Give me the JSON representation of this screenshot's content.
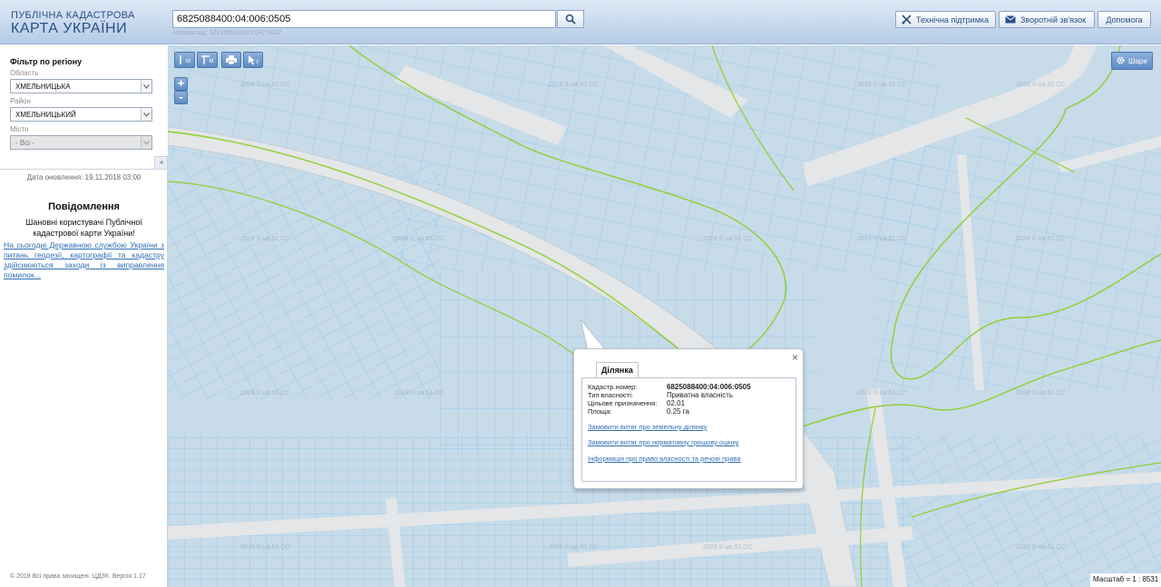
{
  "header": {
    "brand_line1": "ПУБЛІЧНА КАДАСТРОВА",
    "brand_line2": "КАРТА УКРАЇНИ",
    "search_value": "6825088400:04:006:0505",
    "search_example": "Наприклад: 3221655100:01:047:0052",
    "buttons": {
      "support": "Технічна підтримка",
      "feedback": "Зворотній зв'язок",
      "help": "Допомога"
    }
  },
  "sidebar": {
    "filter_title": "Фільтр по регіону",
    "oblast_label": "Область",
    "oblast_value": "ХМЕЛЬНИЦЬКА",
    "rayon_label": "Район",
    "rayon_value": "ХМЕЛЬНИЦЬКИЙ",
    "misto_label": "Місто",
    "misto_value": "- Всі -",
    "update_date": "Дата оновлення: 19.11.2018 03:00",
    "message_title": "Повідомлення",
    "message_greeting": "Шановні користувачі Публічної кадастрової карти України!",
    "message_link": "На сьогодні Державною службою України з питань геодезії, картографії та кадастру здійснюються заходи із виправлення помилок...",
    "copyright": "© 2018 Всі права захищені. ЦДЗК. Версія 1.17"
  },
  "map": {
    "layers_label": "Шари",
    "watermark": "2018 © ua.51.CC",
    "scale_label": "Масштаб = 1 : 8531",
    "zoom_in": "+",
    "zoom_out": "-",
    "tools": {
      "ruler_label": "M",
      "area_label": "M"
    }
  },
  "popup": {
    "tab_label": "Ділянка",
    "rows": [
      {
        "key": "Кадастр.номер:",
        "value": "6825088400:04:006:0505"
      },
      {
        "key": "Тип власності:",
        "value": "Приватна власність"
      },
      {
        "key": "Цільове призначення:",
        "value": "02.01"
      },
      {
        "key": "Площа:",
        "value": "0.25 га"
      }
    ],
    "links": [
      "Замовити витяг про земельну ділянку",
      "Замовити витяг про нормативну грошову оцінку",
      "Інформація про право власності та речові права"
    ],
    "close": "×"
  },
  "colors": {
    "header_text": "#2a4f86",
    "link": "#2f6db3",
    "map_parcel": "#c7dbe9",
    "map_road": "#e4e6e8",
    "parcel_line": "#7fc0ee",
    "boundary_line": "#8fcf2e"
  }
}
